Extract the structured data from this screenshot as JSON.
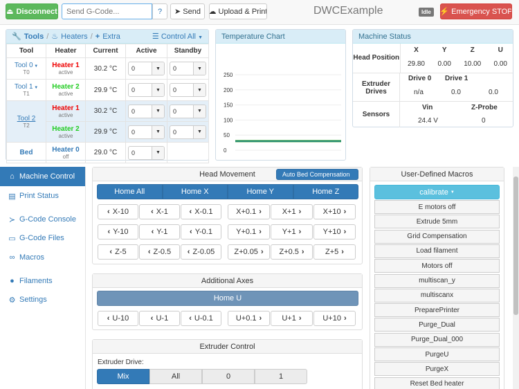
{
  "navbar": {
    "disconnect_label": "Disconnect",
    "gcode_placeholder": "Send G-Code...",
    "help_label": "?",
    "send_label": "Send",
    "upload_label": "Upload & Print",
    "title": "DWCExample",
    "status_badge": "Idle",
    "estop_label": "Emergency STOP"
  },
  "tools_panel": {
    "tabs": {
      "tools": "Tools",
      "heaters": "Heaters",
      "extra": "Extra",
      "sep": "/"
    },
    "control_all": "Control All",
    "headers": [
      "Tool",
      "Heater",
      "Current",
      "Active",
      "Standby"
    ],
    "rows": [
      {
        "tool": "Tool 0",
        "tool_sub": "T0",
        "heater": "Heater 1",
        "heater_state": "active",
        "current": "30.2 °C",
        "active": "0",
        "standby": "0"
      },
      {
        "tool": "Tool 1",
        "tool_sub": "T1",
        "heater": "Heater 2",
        "heater_state": "active",
        "current": "29.9 °C",
        "active": "0",
        "standby": "0"
      },
      {
        "tool": "Tool 2",
        "tool_sub": "T2",
        "heater": "Heater 1",
        "heater_state": "active",
        "current": "30.2 °C",
        "active": "0",
        "standby": "0"
      },
      {
        "tool": "",
        "tool_sub": "",
        "heater": "Heater 2",
        "heater_state": "active",
        "current": "29.9 °C",
        "active": "0",
        "standby": "0"
      },
      {
        "tool": "Bed",
        "tool_sub": "",
        "heater": "Heater 0",
        "heater_state": "off",
        "current": "29.0 °C",
        "active": "0",
        "standby": ""
      }
    ]
  },
  "temp_chart": {
    "title": "Temperature Chart",
    "chart_data": {
      "type": "line",
      "title": "",
      "ylim": [
        0,
        250
      ],
      "yticks": [
        "250",
        "200",
        "150",
        "100",
        "50",
        "0"
      ],
      "series": [
        {
          "values": [
            30.2,
            30.2,
            30.2,
            30.2
          ],
          "color": "#2ca02c"
        },
        {
          "values": [
            29.9,
            29.9,
            29.9,
            29.9
          ],
          "color": "#1f77b4"
        }
      ]
    }
  },
  "machine_status": {
    "title": "Machine Status",
    "head_position_label": "Head Position",
    "axes": [
      "X",
      "Y",
      "Z",
      "U"
    ],
    "axes_values": [
      "29.80",
      "0.00",
      "10.00",
      "0.00"
    ],
    "extruder_label": "Extruder Drives",
    "drives": [
      "Drive 0",
      "Drive 1"
    ],
    "drive_values": [
      "n/a",
      "0.0",
      "0.0"
    ],
    "sensors_label": "Sensors",
    "sensor_names": [
      "Vin",
      "Z-Probe"
    ],
    "sensor_values": [
      "24.4 V",
      "0"
    ]
  },
  "sidebar": {
    "items": [
      {
        "label": "Machine Control",
        "icon": "home-icon"
      },
      {
        "label": "Print Status",
        "icon": "print-icon"
      },
      {
        "label": "G-Code Console",
        "icon": "terminal-icon"
      },
      {
        "label": "G-Code Files",
        "icon": "file-icon"
      },
      {
        "label": "Macros",
        "icon": "link-icon"
      },
      {
        "label": "Filaments",
        "icon": "globe-icon"
      },
      {
        "label": "Settings",
        "icon": "gear-icon"
      }
    ]
  },
  "head_movement": {
    "title": "Head Movement",
    "bed_comp": "Auto Bed Compensation",
    "home_buttons": [
      "Home All",
      "Home X",
      "Home Y",
      "Home Z"
    ],
    "rows": [
      [
        "X-10",
        "X-1",
        "X-0.1",
        "X+0.1",
        "X+1",
        "X+10"
      ],
      [
        "Y-10",
        "Y-1",
        "Y-0.1",
        "Y+0.1",
        "Y+1",
        "Y+10"
      ],
      [
        "Z-5",
        "Z-0.5",
        "Z-0.05",
        "Z+0.05",
        "Z+0.5",
        "Z+5"
      ]
    ]
  },
  "additional_axes": {
    "title": "Additional Axes",
    "home_u": "Home U",
    "row": [
      "U-10",
      "U-1",
      "U-0.1",
      "U+0.1",
      "U+1",
      "U+10"
    ]
  },
  "extruder_control": {
    "title": "Extruder Control",
    "drive_label": "Extruder Drive:",
    "options": [
      "Mix",
      "All",
      "0",
      "1"
    ]
  },
  "macros": {
    "title": "User-Defined Macros",
    "folder": "calibrate",
    "items": [
      "E motors off",
      "Extrude 5mm",
      "Grid Compensation",
      "Load filament",
      "Motors off",
      "multiscan_y",
      "multiscanx",
      "PreparePrinter",
      "Purge_Dual",
      "Purge_Dual_000",
      "PurgeU",
      "PurgeX",
      "Reset Bed heater"
    ]
  }
}
